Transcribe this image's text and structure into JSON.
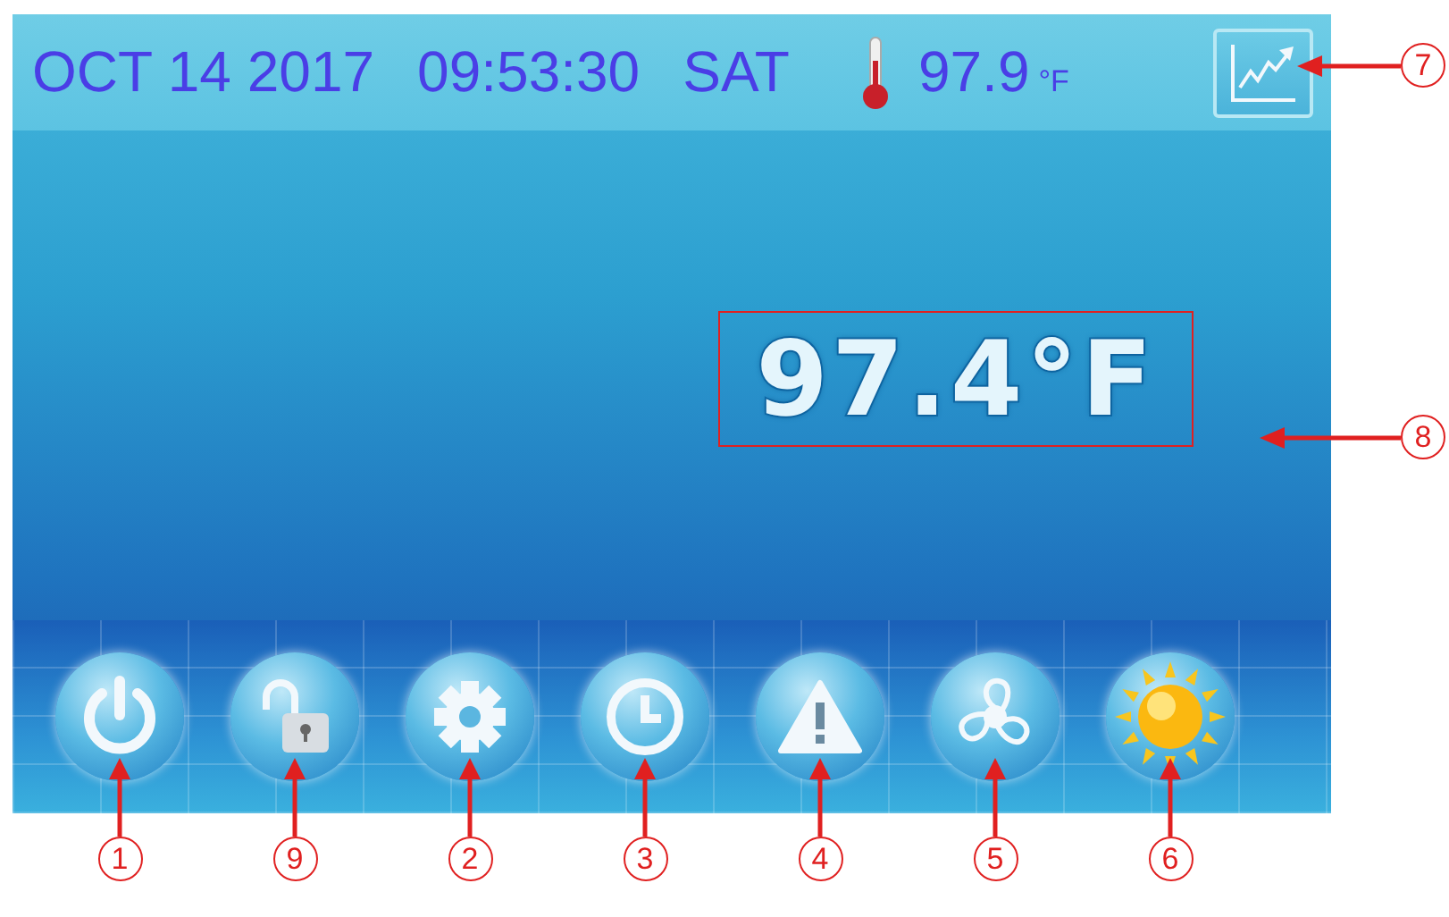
{
  "status_bar": {
    "date": "OCT 14 2017",
    "time": "09:53:30",
    "weekday": "SAT",
    "temperature": "97.9",
    "unit": "°F",
    "chart_callout": "7"
  },
  "reading": {
    "value": "97.4°F",
    "callout": "8"
  },
  "dock": [
    {
      "kind": "power",
      "callout": "1"
    },
    {
      "kind": "unlock",
      "callout": "9"
    },
    {
      "kind": "settings",
      "callout": "2"
    },
    {
      "kind": "clock",
      "callout": "3"
    },
    {
      "kind": "alert",
      "callout": "4"
    },
    {
      "kind": "fan",
      "callout": "5"
    },
    {
      "kind": "sun",
      "callout": "6"
    }
  ]
}
